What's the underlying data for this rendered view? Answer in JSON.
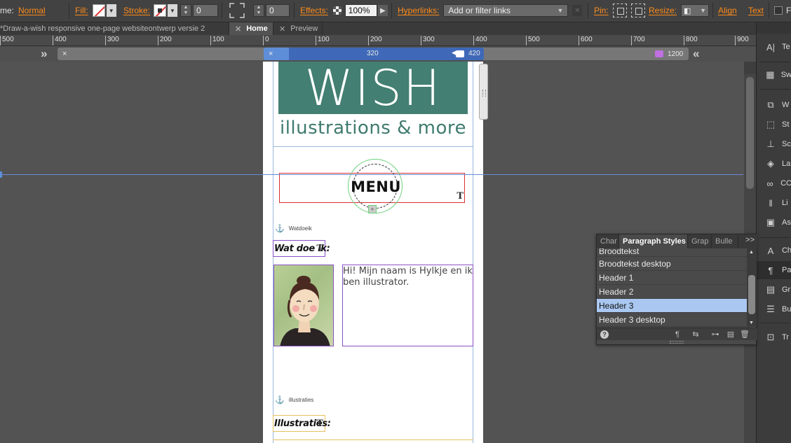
{
  "control_bar": {
    "frame_label": "me:",
    "blend_mode": "Normal",
    "fill_label": "Fill:",
    "stroke_label": "Stroke:",
    "stroke_weight": "0",
    "corner_value": "0",
    "effects_label": "Effects:",
    "opacity": "100%",
    "hyperlinks_label": "Hyperlinks:",
    "hyperlinks_placeholder": "Add or filter links",
    "pin_label": "Pin:",
    "resize_label": "Resize:",
    "align_label": "Align",
    "text_label": "Text",
    "extra_label": "Fo"
  },
  "tabs": [
    {
      "label": "*Draw-a-wish responsive one-page websiteontwerp versie 2"
    },
    {
      "label": "Home"
    },
    {
      "label": "Preview"
    }
  ],
  "ruler": {
    "ticks": [
      "500",
      "400",
      "300",
      "200",
      "100",
      "0",
      "100",
      "200",
      "300",
      "400",
      "500",
      "600",
      "700",
      "800",
      "900"
    ]
  },
  "breakpoints": {
    "current_width": "320",
    "breakpoint_1": "420",
    "breakpoint_2": "1200",
    "close_glyph": "×"
  },
  "page": {
    "logo_word": "WISH",
    "tagline": "illustrations & more",
    "menu_label": "MENU",
    "anchor_1": "Watdoeik",
    "heading_1": "Wat doe ik:",
    "intro_text": "Hi! Mijn naam is Hylkje en ik ben illustrator.",
    "anchor_2": "illustraties",
    "heading_2": "Illustraties:"
  },
  "paragraph_panel": {
    "tabs": [
      {
        "label": "Char"
      },
      {
        "label": "Paragraph Styles"
      },
      {
        "label": "Grap"
      },
      {
        "label": "Bulle"
      }
    ],
    "menu_glyph": ">>",
    "styles": [
      {
        "label": "Broodtekst"
      },
      {
        "label": "Broodtekst desktop"
      },
      {
        "label": "Header 1"
      },
      {
        "label": "Header 2"
      },
      {
        "label": "Header 3"
      },
      {
        "label": "Header 3 desktop"
      }
    ],
    "selected": "Header 3"
  },
  "dock": {
    "items": [
      {
        "label": "Te"
      },
      {
        "label": "Sw"
      },
      {
        "label": "W"
      },
      {
        "label": "St"
      },
      {
        "label": "Sc"
      },
      {
        "label": "La"
      },
      {
        "label": "CC"
      },
      {
        "label": "Li"
      },
      {
        "label": "As"
      },
      {
        "label": "Ch"
      },
      {
        "label": "Pa"
      },
      {
        "label": "Gr"
      },
      {
        "label": "Bu"
      },
      {
        "label": "Tr"
      }
    ]
  },
  "colors": {
    "accent_orange": "#ff8c1a",
    "logo_green": "#437f72",
    "selection_blue": "#a9c7f0",
    "breakpoint_blue": "#3f69b8",
    "frame_red": "#d83030",
    "frame_purple": "#8a50c8"
  }
}
